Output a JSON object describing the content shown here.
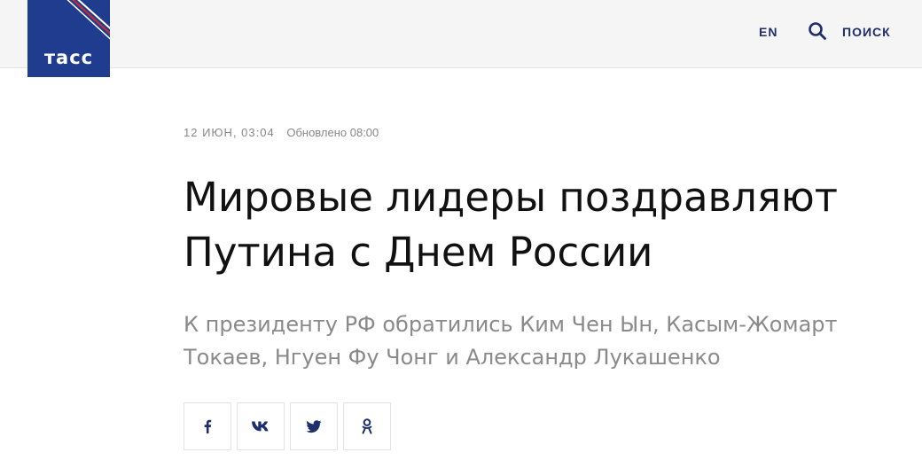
{
  "header": {
    "logo_text": "тасс",
    "lang_label": "EN",
    "search_label": "ПОИСК"
  },
  "article": {
    "date": "12 ИЮН, 03:04",
    "updated": "Обновлено 08:00",
    "title": "Мировые лидеры поздравляют Путина с Днем России",
    "lead": "К президенту РФ обратились Ким Чен Ын, Касым-Жомарт Токаев, Нгуен Фу Чонг и Александр Лукашенко"
  },
  "share": {
    "buttons": [
      {
        "icon": "facebook-icon"
      },
      {
        "icon": "vk-icon"
      },
      {
        "icon": "twitter-icon"
      },
      {
        "icon": "odnoklassniki-icon"
      }
    ]
  },
  "colors": {
    "brand_blue": "#1f3c8f",
    "nav_text": "#1f2f6b",
    "header_bg": "#f5f5f5",
    "lead_text": "#8a8a8a"
  }
}
